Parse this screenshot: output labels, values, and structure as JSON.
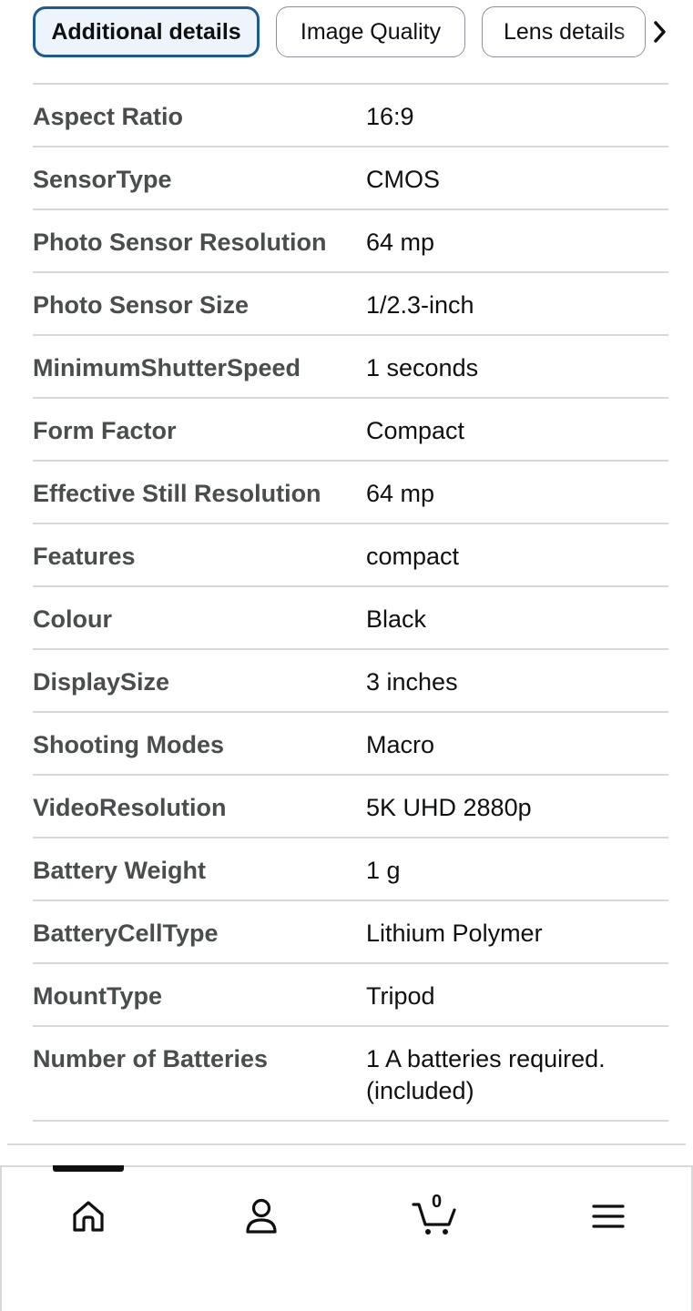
{
  "tabs": [
    {
      "label": "Additional details",
      "active": true
    },
    {
      "label": "Image Quality",
      "active": false
    },
    {
      "label": "Lens details",
      "active": false
    }
  ],
  "tabs_next_icon": "chevron-right-icon",
  "specs": [
    {
      "label": "Aspect Ratio",
      "value": "16:9"
    },
    {
      "label": "SensorType",
      "value": "CMOS"
    },
    {
      "label": "Photo Sensor Resolution",
      "value": "64 mp"
    },
    {
      "label": "Photo Sensor Size",
      "value": "1/2.3-inch"
    },
    {
      "label": "MinimumShutterSpeed",
      "value": "1 seconds"
    },
    {
      "label": "Form Factor",
      "value": "Compact"
    },
    {
      "label": "Effective Still Resolution",
      "value": "64 mp"
    },
    {
      "label": "Features",
      "value": "compact"
    },
    {
      "label": "Colour",
      "value": "Black"
    },
    {
      "label": "DisplaySize",
      "value": "3 inches"
    },
    {
      "label": "Shooting Modes",
      "value": "Macro"
    },
    {
      "label": "VideoResolution",
      "value": "5K UHD 2880p"
    },
    {
      "label": "Battery Weight",
      "value": "1 g"
    },
    {
      "label": "BatteryCellType",
      "value": "Lithium Polymer"
    },
    {
      "label": "MountType",
      "value": "Tripod"
    },
    {
      "label": "Number of Batteries",
      "value": "1 A batteries required. (included)"
    }
  ],
  "bottom_nav": {
    "items": [
      "home-icon",
      "account-icon",
      "cart-icon",
      "menu-icon"
    ],
    "cart_count": "0",
    "active_index": 0
  },
  "colors": {
    "active_tab_border": "#1f5a8c",
    "label_text": "#494d4d",
    "divider": "#d8d8d8"
  }
}
